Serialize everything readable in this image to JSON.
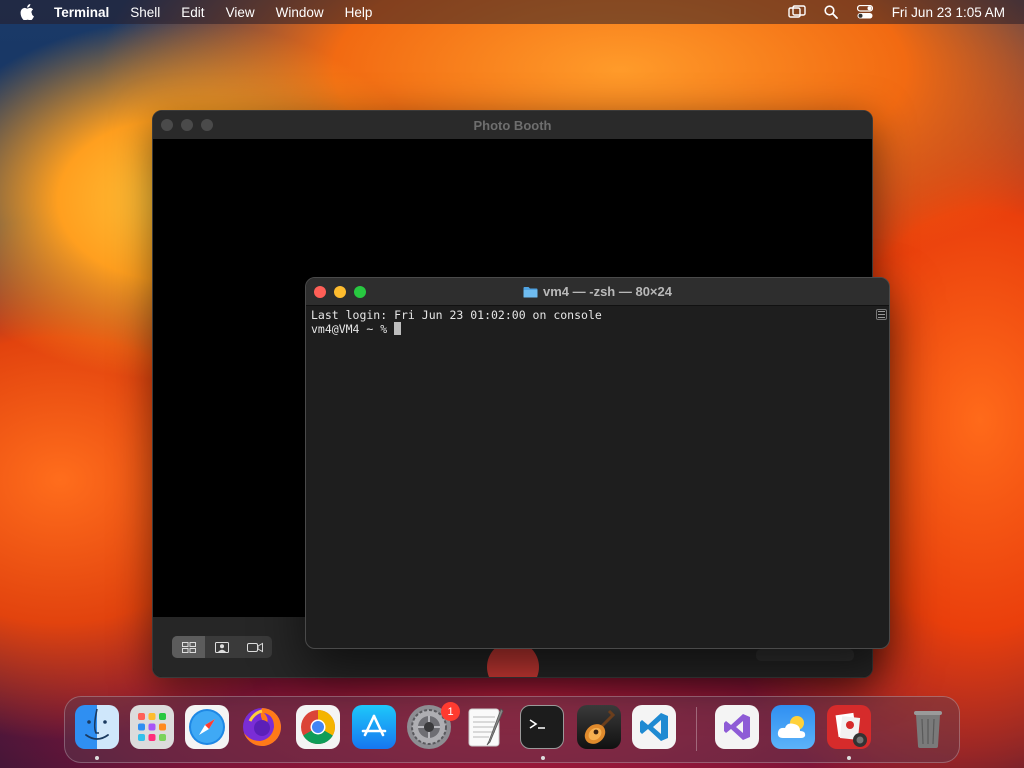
{
  "menubar": {
    "app_name": "Terminal",
    "items": [
      "Shell",
      "Edit",
      "View",
      "Window",
      "Help"
    ],
    "clock": "Fri Jun 23  1:05 AM"
  },
  "photobooth": {
    "title": "Photo Booth"
  },
  "terminal": {
    "title": "vm4 — -zsh — 80×24",
    "lines": [
      "Last login: Fri Jun 23 01:02:00 on console",
      "vm4@VM4 ~ % "
    ]
  },
  "dock": {
    "settings_badge": "1",
    "icons": [
      "finder-icon",
      "launchpad-icon",
      "safari-icon",
      "firefox-icon",
      "chrome-icon",
      "app-store-icon",
      "system-settings-icon",
      "textedit-icon",
      "terminal-icon",
      "garageband-icon",
      "vscode-icon",
      "visual-studio-icon",
      "weather-icon",
      "photo-booth-icon",
      "trash-icon"
    ]
  },
  "colors": {
    "close": "#ff5f57",
    "minimize": "#febc2e",
    "zoom": "#28c840",
    "shutter": "#d23b36",
    "badge": "#ff3b30"
  }
}
